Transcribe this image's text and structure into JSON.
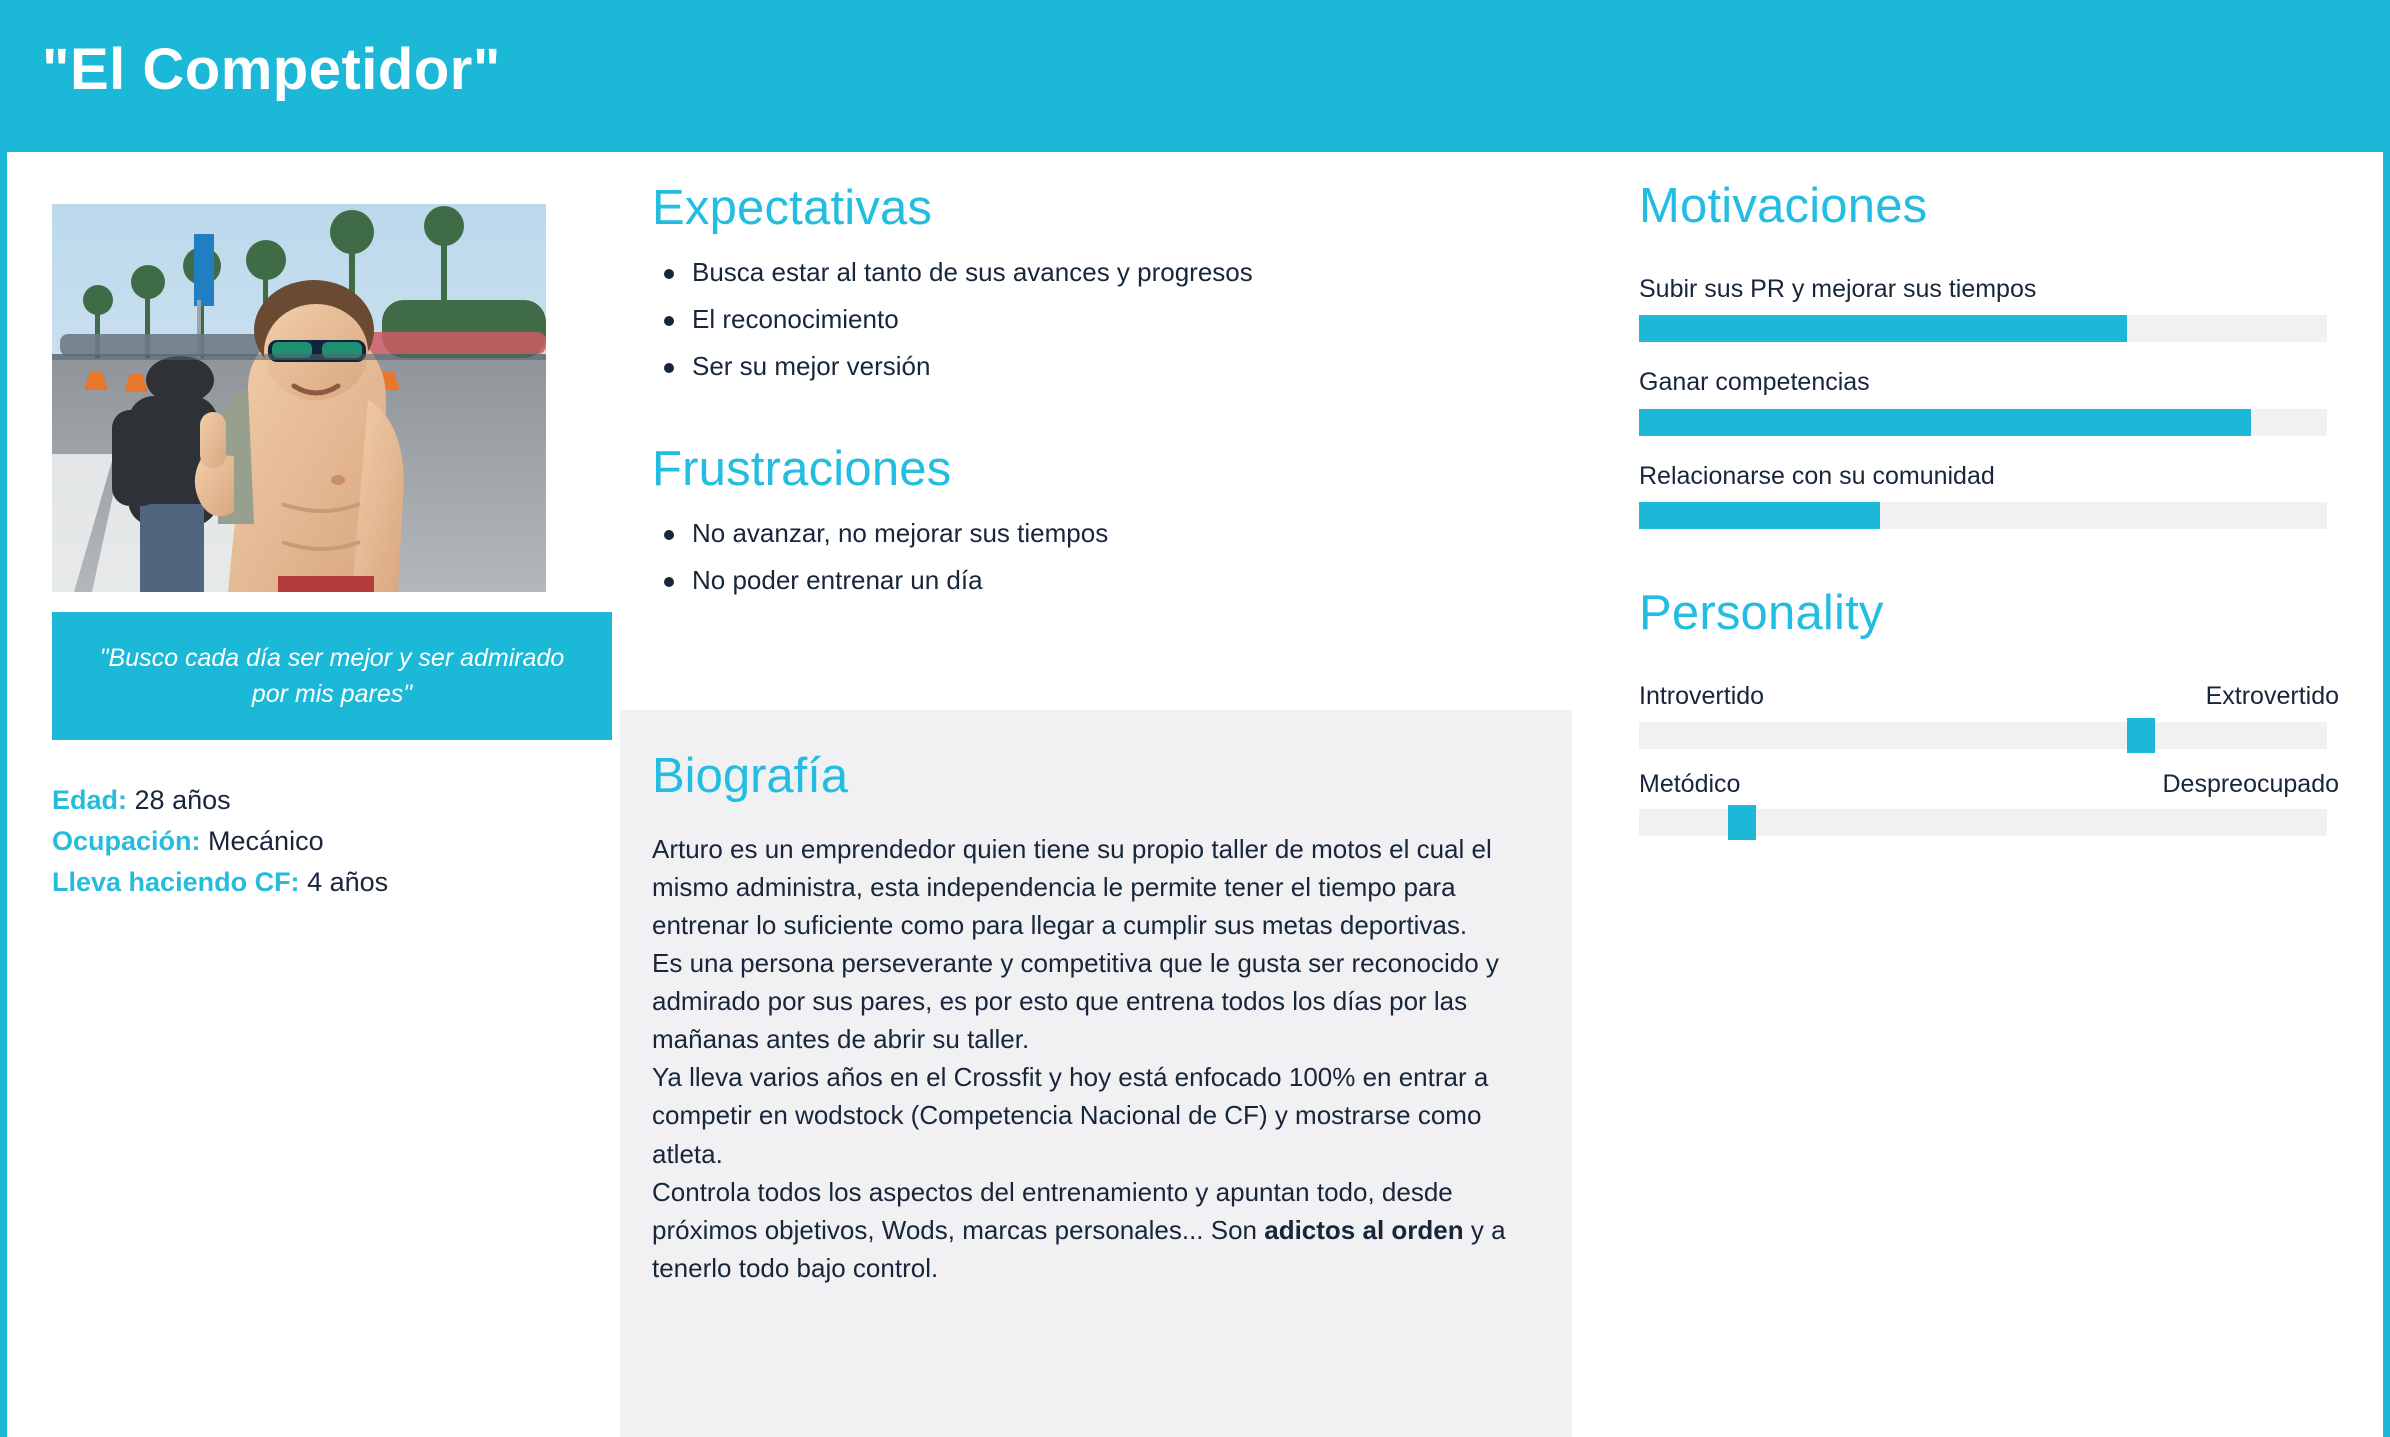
{
  "header": {
    "title": "\"El Competidor\""
  },
  "profile": {
    "photo_alt": "persona-photo-athlete-thumbs-up",
    "quote": "\"Busco cada día ser mejor y ser admirado por mis pares\"",
    "facts": [
      {
        "label": "Edad:",
        "value": "28 años"
      },
      {
        "label": "Ocupación:",
        "value": "Mecánico"
      },
      {
        "label": "Lleva haciendo CF:",
        "value": "4 años"
      }
    ]
  },
  "expectativas": {
    "heading": "Expectativas",
    "items": [
      "Busca estar al tanto de sus avances y progresos",
      "El reconocimiento",
      "Ser su mejor versión"
    ]
  },
  "frustraciones": {
    "heading": "Frustraciones",
    "items": [
      "No avanzar, no mejorar sus tiempos",
      "No poder entrenar un día"
    ]
  },
  "biografia": {
    "heading": "Biografía",
    "paragraphs": [
      "Arturo es un emprendedor quien tiene su propio taller de motos el cual el mismo administra, esta independencia le permite tener el tiempo para entrenar lo suficiente como para llegar a cumplir sus metas deportivas.",
      "Es una persona perseverante y competitiva que le gusta ser reconocido y admirado por sus pares, es por esto que entrena todos los días por las mañanas antes de abrir su taller.",
      "Ya lleva varios años en el Crossfit y hoy está enfocado 100% en entrar a competir en wodstock (Competencia Nacional de CF) y mostrarse como atleta."
    ],
    "last_paragraph_prefix": "Controla todos los aspectos del entrenamiento y apuntan todo, desde próximos objetivos, Wods, marcas personales... Son ",
    "last_paragraph_bold": "adictos al orden",
    "last_paragraph_suffix": " y a tenerlo todo bajo control."
  },
  "motivaciones": {
    "heading": "Motivaciones",
    "items": [
      {
        "label": "Subir sus PR y mejorar sus tiempos",
        "value": 71
      },
      {
        "label": "Ganar competencias",
        "value": 89
      },
      {
        "label": "Relacionarse con su comunidad",
        "value": 35
      }
    ]
  },
  "personality": {
    "heading": "Personality",
    "items": [
      {
        "left_label": "Introvertido",
        "right_label": "Extrovertido",
        "value": 73
      },
      {
        "left_label": "Metódico",
        "right_label": "Despreocupado",
        "value": 15
      }
    ]
  },
  "colors": {
    "accent": "#1bb8d8",
    "heading": "#22bde0",
    "text": "#17263a",
    "track": "#f1f1f3",
    "panel": "#f1f1f3"
  }
}
